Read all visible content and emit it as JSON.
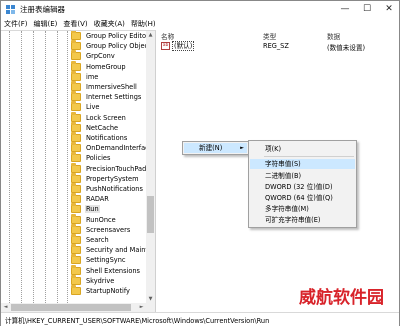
{
  "window": {
    "title": "注册表编辑器",
    "controls": {
      "minimize": "—",
      "maximize": "☐",
      "close": "✕"
    }
  },
  "menubar": [
    "文件(F)",
    "编辑(E)",
    "查看(V)",
    "收藏夹(A)",
    "帮助(H)"
  ],
  "tree": {
    "items": [
      {
        "label": "Group Policy Editor"
      },
      {
        "label": "Group Policy Objec"
      },
      {
        "label": "GrpConv"
      },
      {
        "label": "HomeGroup"
      },
      {
        "label": "ime"
      },
      {
        "label": "ImmersiveShell"
      },
      {
        "label": "Internet Settings"
      },
      {
        "label": "Live"
      },
      {
        "label": "Lock Screen"
      },
      {
        "label": "NetCache"
      },
      {
        "label": "Notifications"
      },
      {
        "label": "OnDemandInterface"
      },
      {
        "label": "Policies"
      },
      {
        "label": "PrecisionTouchPad"
      },
      {
        "label": "PropertySystem"
      },
      {
        "label": "PushNotifications"
      },
      {
        "label": "RADAR"
      },
      {
        "label": "Run",
        "selected": true
      },
      {
        "label": "RunOnce"
      },
      {
        "label": "Screensavers"
      },
      {
        "label": "Search"
      },
      {
        "label": "Security and Mainte"
      },
      {
        "label": "SettingSync"
      },
      {
        "label": "Shell Extensions"
      },
      {
        "label": "Skydrive"
      },
      {
        "label": "StartupNotify"
      }
    ]
  },
  "values": {
    "columns": {
      "name": "名称",
      "type": "类型",
      "data": "数据"
    },
    "rows": [
      {
        "icon": "ab",
        "name": "(默认)",
        "type": "REG_SZ",
        "data": "(数值未设置)"
      }
    ]
  },
  "context_menu": {
    "new_label": "新建(N)",
    "new_arrow": "►"
  },
  "submenu": {
    "items": [
      {
        "label": "项(K)"
      },
      {
        "label": "字符串值(S)",
        "highlighted": true
      },
      {
        "label": "二进制值(B)"
      },
      {
        "label": "DWORD (32 位)值(D)"
      },
      {
        "label": "QWORD (64 位)值(Q)"
      },
      {
        "label": "多字符串值(M)"
      },
      {
        "label": "可扩充字符串值(E)"
      }
    ]
  },
  "statusbar": {
    "path": "计算机\\HKEY_CURRENT_USER\\SOFTWARE\\Microsoft\\Windows\\CurrentVersion\\Run"
  },
  "watermark": "威航软件园",
  "colors": {
    "folder": "#f3c84b",
    "highlight": "#cce8ff",
    "watermark": "#d8232a"
  }
}
